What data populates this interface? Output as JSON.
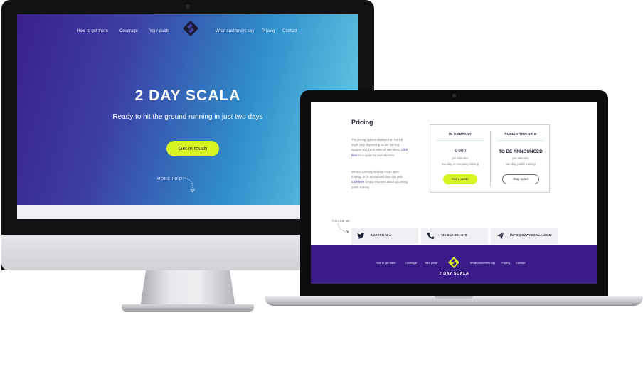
{
  "imac": {
    "nav": [
      "How to get there",
      "Coverage",
      "Your guide",
      "What customers say",
      "Pricing",
      "Contact"
    ],
    "title": "2 DAY SCALA",
    "tagline": "Ready to hit the ground running in just two days",
    "cta": "Get in touch",
    "more_info": "MORE INFO",
    "logo_icon": "brand-logo-icon",
    "colors": {
      "gradient_start": "#3a1f8e",
      "gradient_end": "#6cd3e8",
      "accent": "#d7f424"
    }
  },
  "laptop": {
    "pricing": {
      "heading": "Pricing",
      "para1_a": "The pricing options displayed on the left might vary, depending on the training location and the number of attendees.",
      "para1_link": "Click here",
      "para1_b": "for a quote for your situation.",
      "para2_a": "We are currently working on an open training, to be announced later this year.",
      "para2_link": "Click here",
      "para2_b": "to stay informed about upcoming public training.",
      "in_company": {
        "title": "IN-COMPANY",
        "price": "€ 900",
        "per": "per attendee",
        "desc": "two day, in-company training",
        "button": "Get a quote"
      },
      "public": {
        "title": "PUBLIC TRAINING",
        "announce": "TO BE ANNOUNCED",
        "per": "per attendee",
        "desc": "two day, public training",
        "button": "Stay tuned"
      }
    },
    "follow_me": "FOLLOW ME",
    "social": [
      {
        "icon": "twitter-icon",
        "label": "2DAYSCALA"
      },
      {
        "icon": "phone-icon",
        "label": "+31 612 881 670"
      },
      {
        "icon": "send-icon",
        "label": "INFO@2DAYSCALA.COM"
      }
    ],
    "footer": {
      "nav": [
        "How to get there",
        "Coverage",
        "Your guide",
        "What customers say",
        "Pricing",
        "Contact"
      ],
      "brand": "2 DAY SCALA",
      "colors": {
        "background": "#3a1b87",
        "logo": "#d7f424"
      }
    }
  }
}
